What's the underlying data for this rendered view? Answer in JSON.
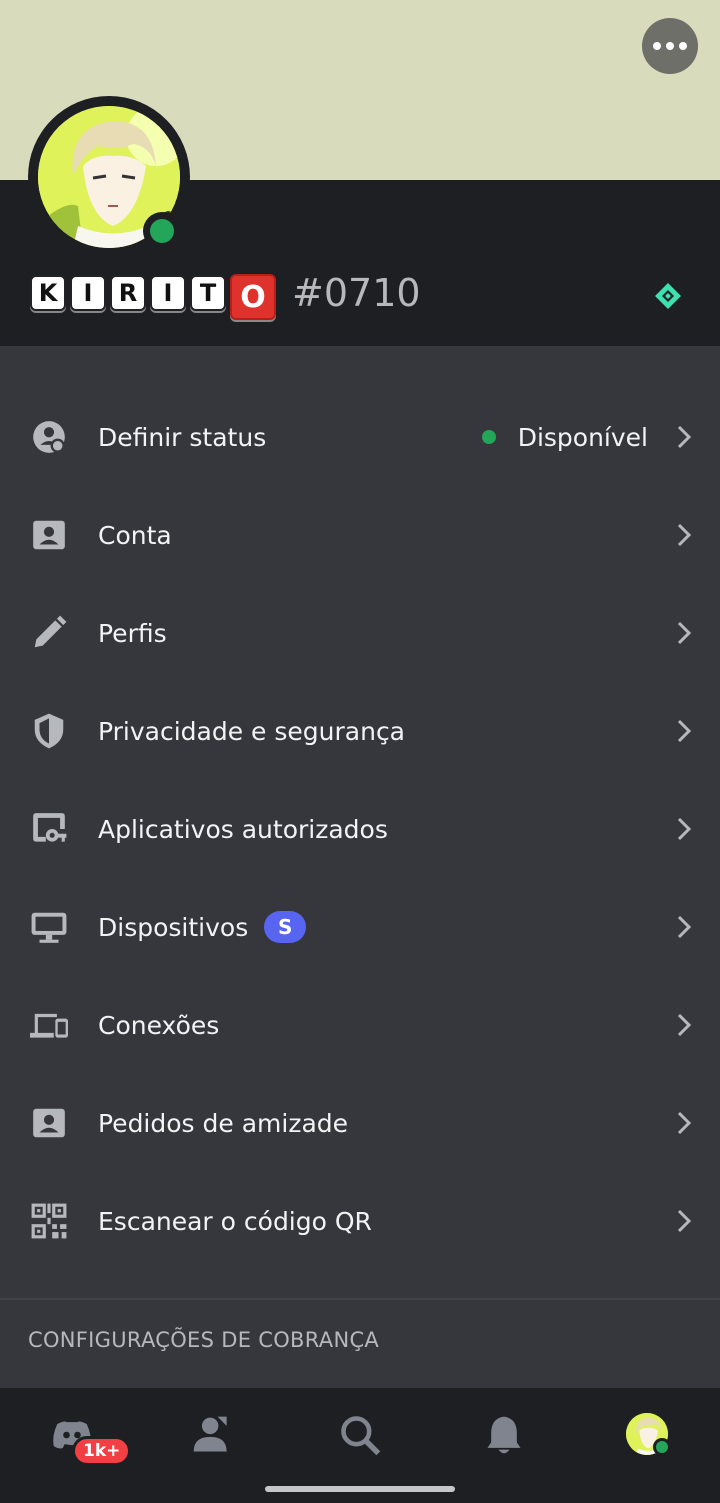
{
  "profile": {
    "username_letters": [
      "K",
      "I",
      "R",
      "I",
      "T",
      "O"
    ],
    "discriminator": "#0710",
    "more_icon": "ellipsis-icon",
    "badge_icon": "nitro-gem-icon",
    "status_color": "#23a55a"
  },
  "menu": {
    "items": [
      {
        "label": "Definir status",
        "icon": "status-icon",
        "value": "Disponível"
      },
      {
        "label": "Conta",
        "icon": "account-icon"
      },
      {
        "label": "Perfis",
        "icon": "pencil-icon"
      },
      {
        "label": "Privacidade e segurança",
        "icon": "shield-icon"
      },
      {
        "label": "Aplicativos autorizados",
        "icon": "authorized-apps-icon"
      },
      {
        "label": "Dispositivos",
        "icon": "monitor-icon",
        "pill": "S"
      },
      {
        "label": "Conexões",
        "icon": "connections-icon"
      },
      {
        "label": "Pedidos de amizade",
        "icon": "friend-requests-icon"
      },
      {
        "label": "Escanear o código QR",
        "icon": "qr-code-icon"
      }
    ]
  },
  "section": {
    "billing_title": "CONFIGURAÇÕES DE COBRANÇA"
  },
  "bottom_nav": {
    "home_badge": "1k+",
    "items": [
      "home-icon",
      "friends-icon",
      "search-icon",
      "bell-icon",
      "profile-avatar"
    ]
  },
  "colors": {
    "banner": "#d9dbbd",
    "header": "#1e1f23",
    "background": "#36373d",
    "accent": "#5865f2",
    "online": "#23a55a"
  }
}
